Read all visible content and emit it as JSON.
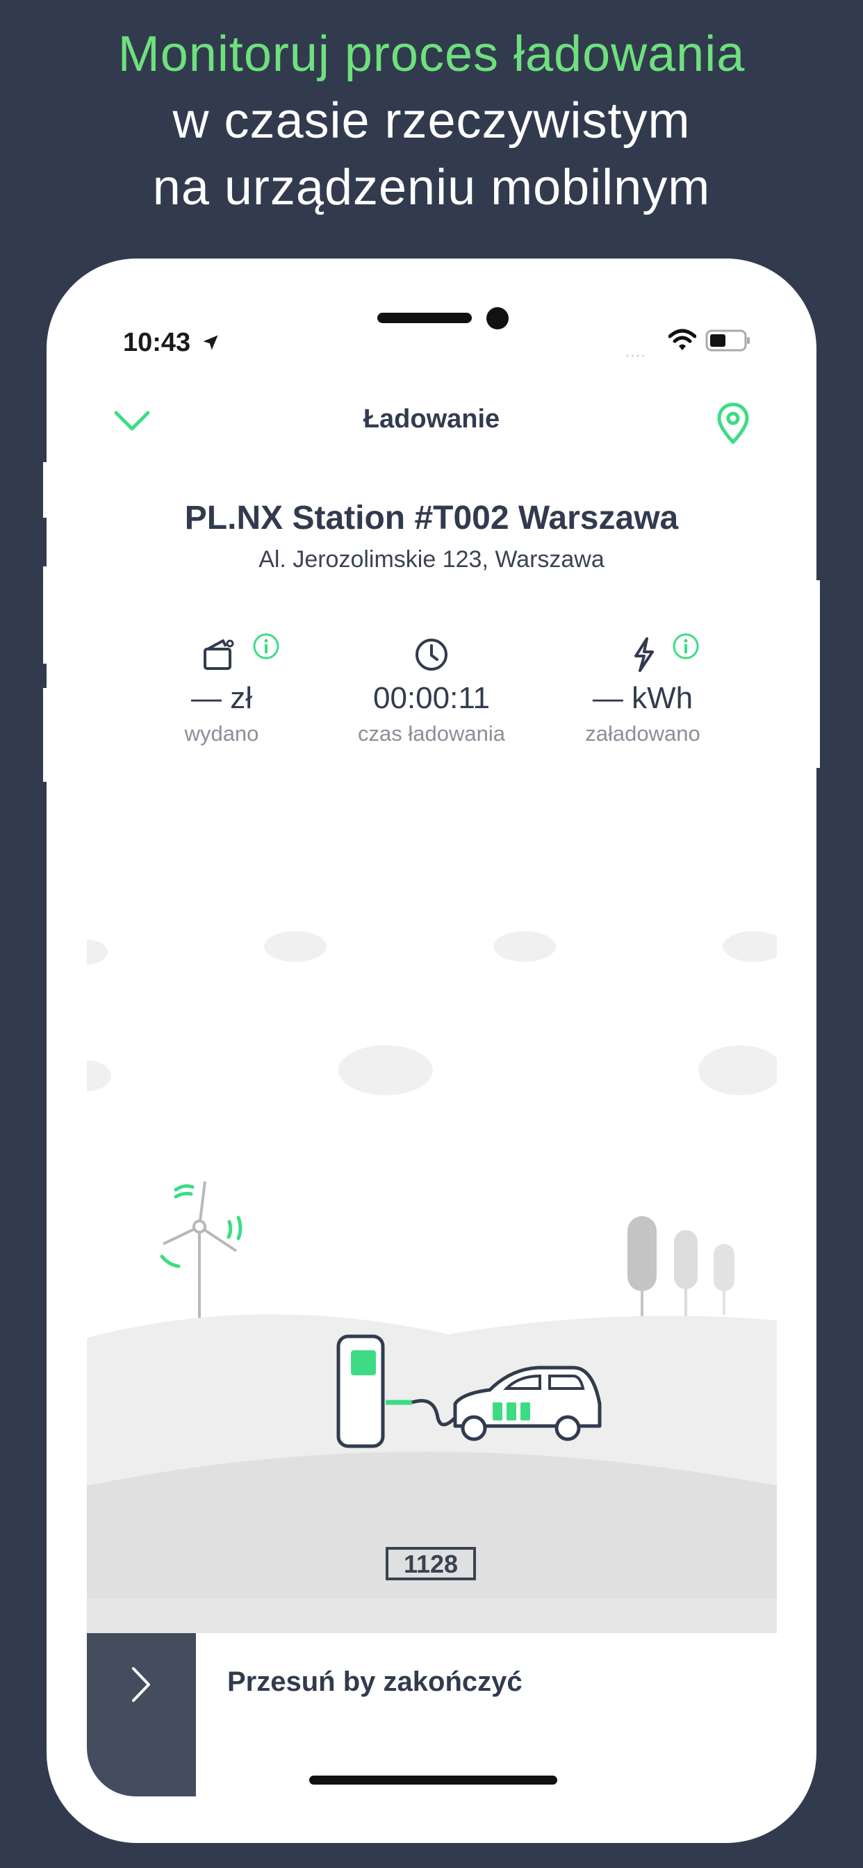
{
  "headline": {
    "line1": "Monitoruj proces ładowania",
    "line2": "w czasie rzeczywistym",
    "line3": "na urządzeniu mobilnym"
  },
  "status_bar": {
    "time": "10:43"
  },
  "nav": {
    "title": "Ładowanie"
  },
  "station": {
    "name": "PL.NX Station #T002 Warszawa",
    "address": "Al. Jerozolimskie 123, Warszawa"
  },
  "stats": [
    {
      "value": "— zł",
      "label": "wydano",
      "icon": "wallet-icon",
      "info": true
    },
    {
      "value": "00:00:11",
      "label": "czas ładowania",
      "icon": "clock-icon",
      "info": false
    },
    {
      "value": "— kWh",
      "label": "załadowano",
      "icon": "lightning-icon",
      "info": true
    }
  ],
  "illustration": {
    "plate": "1128"
  },
  "slider": {
    "label": "Przesuń by zakończyć"
  },
  "colors": {
    "accent": "#3ddc84",
    "background": "#323b4e",
    "headline_accent": "#6ee07e"
  }
}
